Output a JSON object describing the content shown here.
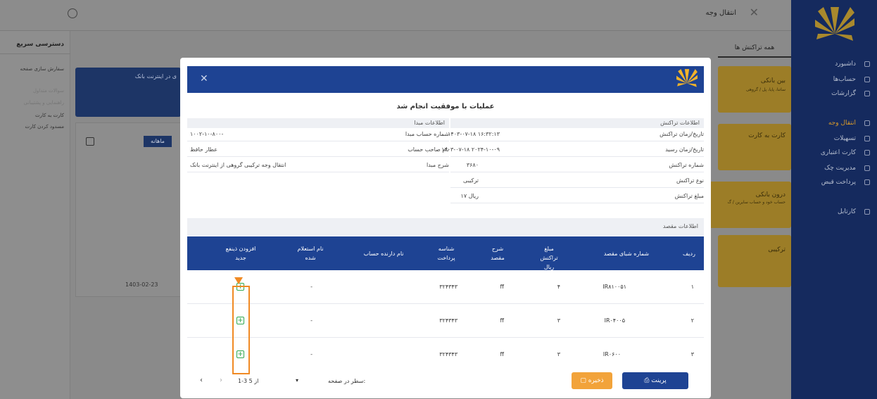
{
  "app": {
    "title": "انتقال وجه",
    "tab": "همه تراکنش ها"
  },
  "sidebar": {
    "items": [
      {
        "label": "داشبورد"
      },
      {
        "label": "حساب‌ها"
      },
      {
        "label": "گزارشات"
      },
      {
        "label": "انتقال وجه"
      },
      {
        "label": "تسهیلات"
      },
      {
        "label": "کارت اعتباری"
      },
      {
        "label": "مدیریت چک"
      },
      {
        "label": "پرداخت قبض"
      },
      {
        "label": "کارتابل"
      }
    ]
  },
  "quick_access": {
    "title": "دسترسی سریع",
    "customize": "سفارش سازی صفحه",
    "items": [
      "سوالات متداول",
      "راهنمایی و پشتیبانی",
      "کارت به کارت",
      "مسدود کردن کارت"
    ]
  },
  "cards": [
    {
      "title": "بین بانکی",
      "subtitle": "ساتنا، پایا، پل / گروهی"
    },
    {
      "title": "کارت به کارت",
      "subtitle": ""
    },
    {
      "title": "درون بانکی",
      "subtitle": "حساب خود و حساب سایرین / گ"
    },
    {
      "title": "ترکیبی",
      "subtitle": ""
    }
  ],
  "background": {
    "banner_text": "ی در اینترنت بانک",
    "chart_tab": "ماهانه",
    "chart_date": "1403-02-23"
  },
  "modal": {
    "success": "عملیات با موفقیت انجام شد",
    "transaction_section": "اطلاعات تراکنش",
    "origin_section": "اطلاعات مبدا",
    "transaction": [
      {
        "label": "تاریخ/زمان تراکنش",
        "value": "۱۴۰۳-۰۷-۱۸ ۱۶:۳۲:۱۳"
      },
      {
        "label": "تاریخ/زمان رسید",
        "value": "۱۴۰۳-۰۷-۱۸ ۲۰۲۴-۱۰-۰۹"
      },
      {
        "label": "شماره تراکنش",
        "value": "۳۶۸۰"
      },
      {
        "label": "نوع تراکنش",
        "value": "ترکیبی"
      },
      {
        "label": "مبلغ تراکنش",
        "value": "۱۷ ریال"
      }
    ],
    "origin": [
      {
        "label": "شماره حساب مبدا",
        "value": "۱۰۰۲-۱۰-۸۰۰-"
      },
      {
        "label": "نام صاحب حساب",
        "value": "عطار حافظ"
      },
      {
        "label": "شرح مبدا",
        "value": "انتقال وجه ترکیبی گروهی از اینترنت بانک"
      }
    ],
    "destination_section": "اطلاعات مقصد",
    "table": {
      "headers": [
        "ردیف",
        "شماره شبای مقصد",
        "مبلغ تراکنش ریال",
        "شرح مقصد",
        "شناسه پرداخت",
        "نام دارنده حساب",
        "نام استعلام شده",
        "افزودن ذینفع جدید"
      ],
      "rows": [
        {
          "index": "۱",
          "iban": "IR۸۱۰۰۵۱",
          "amount": "۴",
          "desc": "ff",
          "payment_id": "۳۲۴۳۴۳",
          "holder": "",
          "inquired": "-"
        },
        {
          "index": "۲",
          "iban": "IR۰۴۰۰۵",
          "amount": "۳",
          "desc": "ff",
          "payment_id": "۳۲۴۳۴۳",
          "holder": "",
          "inquired": "-"
        },
        {
          "index": "۳",
          "iban": "IR۰۶۰۰",
          "amount": "۳",
          "desc": "ff",
          "payment_id": "۳۲۴۳۴۳",
          "holder": "",
          "inquired": "-"
        }
      ]
    },
    "footer": {
      "print": "پرینت",
      "save": "ذخیره",
      "rows_per_page": "سطر در صفحه:",
      "range": "1-3 از 5"
    }
  },
  "colors": {
    "navy": "#152a5e",
    "modal_header": "#1e4393",
    "accent_orange": "#f2a33a",
    "highlight": "#f08a24",
    "add_green": "#2fa84f"
  }
}
